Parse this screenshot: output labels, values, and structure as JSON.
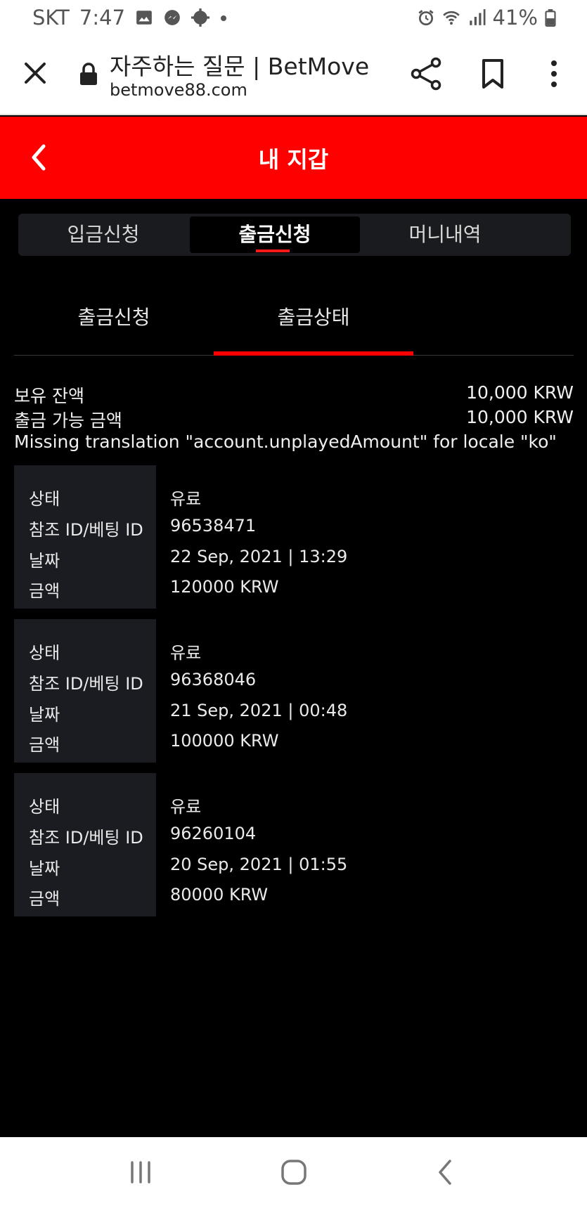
{
  "status_bar": {
    "carrier": "SKT",
    "time": "7:47",
    "battery": "41%",
    "icons_left": [
      "gallery-icon",
      "messenger-icon",
      "settings-cog-icon",
      "dot-icon"
    ],
    "icons_right": [
      "alarm-icon",
      "wifi-icon",
      "signal-icon",
      "battery-icon"
    ]
  },
  "browser": {
    "title": "자주하는 질문 | BetMove",
    "url": "betmove88.com"
  },
  "header": {
    "title": "내 지갑"
  },
  "main_tabs": [
    {
      "label": "입금신청",
      "active": false
    },
    {
      "label": "출금신청",
      "active": true
    },
    {
      "label": "머니내역",
      "active": false
    }
  ],
  "sub_tabs": [
    {
      "label": "출금신청",
      "active": false
    },
    {
      "label": "출금상태",
      "active": true
    }
  ],
  "balance": {
    "held_label": "보유 잔액",
    "held_value": "10,000 KRW",
    "withdrawable_label": "출금 가능 금액",
    "withdrawable_value": "10,000 KRW",
    "missing_translation": "Missing translation \"account.unplayedAmount\" for locale \"ko\""
  },
  "record_labels": {
    "status": "상태",
    "ref_id": "참조 ID/베팅 ID",
    "date": "날짜",
    "amount": "금액"
  },
  "records": [
    {
      "status": "유료",
      "ref_id": "96538471",
      "date": "22 Sep, 2021 | 13:29",
      "amount": "120000 KRW"
    },
    {
      "status": "유료",
      "ref_id": "96368046",
      "date": "21 Sep, 2021 | 00:48",
      "amount": "100000 KRW"
    },
    {
      "status": "유료",
      "ref_id": "96260104",
      "date": "20 Sep, 2021 | 01:55",
      "amount": "80000 KRW"
    }
  ],
  "colors": {
    "brand_red": "#ff0000",
    "background": "#000000",
    "panel": "#1b1c21"
  }
}
